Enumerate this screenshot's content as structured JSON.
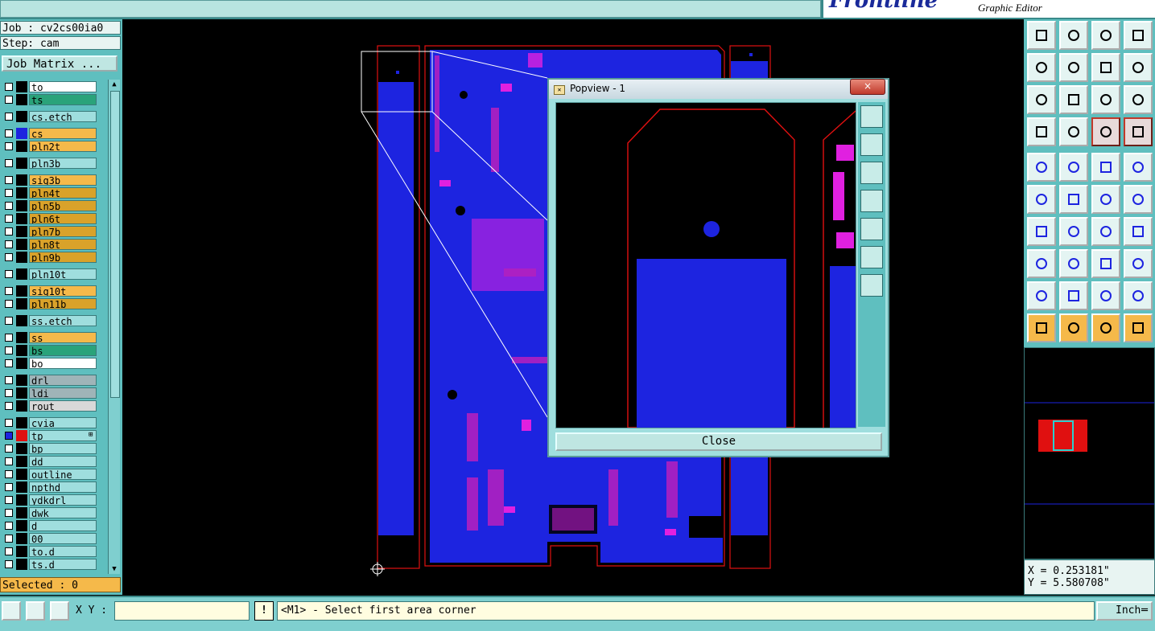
{
  "app": {
    "brand": "Frontline",
    "subtitle": "Graphic Editor"
  },
  "job": {
    "job_line": "Job : cv2cs00ia0",
    "step_line": "Step: cam",
    "matrix_button": "Job Matrix ..."
  },
  "layers": [
    {
      "name": "to",
      "color": "#ffffff",
      "group": 0
    },
    {
      "name": "ts",
      "color": "#2aa37a",
      "group": 0
    },
    {
      "name": "cs.etch",
      "color": "#9fdede",
      "group": 1
    },
    {
      "name": "cs",
      "color": "#f5b94a",
      "group": 2,
      "swatch": "#1d24e0"
    },
    {
      "name": "pln2t",
      "color": "#f5b94a",
      "group": 2
    },
    {
      "name": "pln3b",
      "color": "#9fdede",
      "group": 3
    },
    {
      "name": "sig3b",
      "color": "#f5b94a",
      "group": 4
    },
    {
      "name": "pln4t",
      "color": "#d9a22a",
      "group": 4
    },
    {
      "name": "pln5b",
      "color": "#d9a22a",
      "group": 4
    },
    {
      "name": "pln6t",
      "color": "#d9a22a",
      "group": 4
    },
    {
      "name": "pln7b",
      "color": "#d9a22a",
      "group": 4
    },
    {
      "name": "pln8t",
      "color": "#d9a22a",
      "group": 4
    },
    {
      "name": "pln9b",
      "color": "#d9a22a",
      "group": 4
    },
    {
      "name": "pln10t",
      "color": "#9fdede",
      "group": 5
    },
    {
      "name": "sig10t",
      "color": "#f5b94a",
      "group": 6
    },
    {
      "name": "pln11b",
      "color": "#d9a22a",
      "group": 6
    },
    {
      "name": "ss.etch",
      "color": "#9fdede",
      "group": 7
    },
    {
      "name": "ss",
      "color": "#f5b94a",
      "group": 8
    },
    {
      "name": "bs",
      "color": "#2aa37a",
      "group": 8
    },
    {
      "name": "bo",
      "color": "#ffffff",
      "group": 8
    },
    {
      "name": "drl",
      "color": "#9fb4b8",
      "group": 9
    },
    {
      "name": "ldi",
      "color": "#9fb4b8",
      "group": 9
    },
    {
      "name": "rout",
      "color": "#d8d8d8",
      "group": 9
    },
    {
      "name": "cvia",
      "color": "#9fdede",
      "group": 10
    },
    {
      "name": "tp",
      "color": "#9fdede",
      "group": 10,
      "swatch": "#e01010",
      "selected": true
    },
    {
      "name": "bp",
      "color": "#9fdede",
      "group": 10
    },
    {
      "name": "dd",
      "color": "#9fdede",
      "group": 10
    },
    {
      "name": "outline",
      "color": "#9fdede",
      "group": 10
    },
    {
      "name": "npthd",
      "color": "#9fdede",
      "group": 10
    },
    {
      "name": "ydkdrl",
      "color": "#9fdede",
      "group": 10
    },
    {
      "name": "dwk",
      "color": "#9fdede",
      "group": 10
    },
    {
      "name": "d",
      "color": "#9fdede",
      "group": 10
    },
    {
      "name": "00",
      "color": "#9fdede",
      "group": 10
    },
    {
      "name": "to.d",
      "color": "#9fdede",
      "group": 10
    },
    {
      "name": "ts.d",
      "color": "#9fdede",
      "group": 10
    }
  ],
  "selected_count": "Selected : 0",
  "popview": {
    "title": "Popview - 1",
    "close_x": "×",
    "close_button": "Close"
  },
  "coords": {
    "x": "X = 0.253181\"",
    "y": "Y = 5.580708\""
  },
  "bottom": {
    "xy_label": "X Y :",
    "xy_value": "",
    "warn": "!",
    "status": "<M1> - Select first area corner",
    "units": "Inch"
  },
  "colors": {
    "panel": "#5fbfbf",
    "copper": "#1d24e0",
    "pad": "#e020e0",
    "outline": "#e01010",
    "highlight": "#f5b94a"
  }
}
